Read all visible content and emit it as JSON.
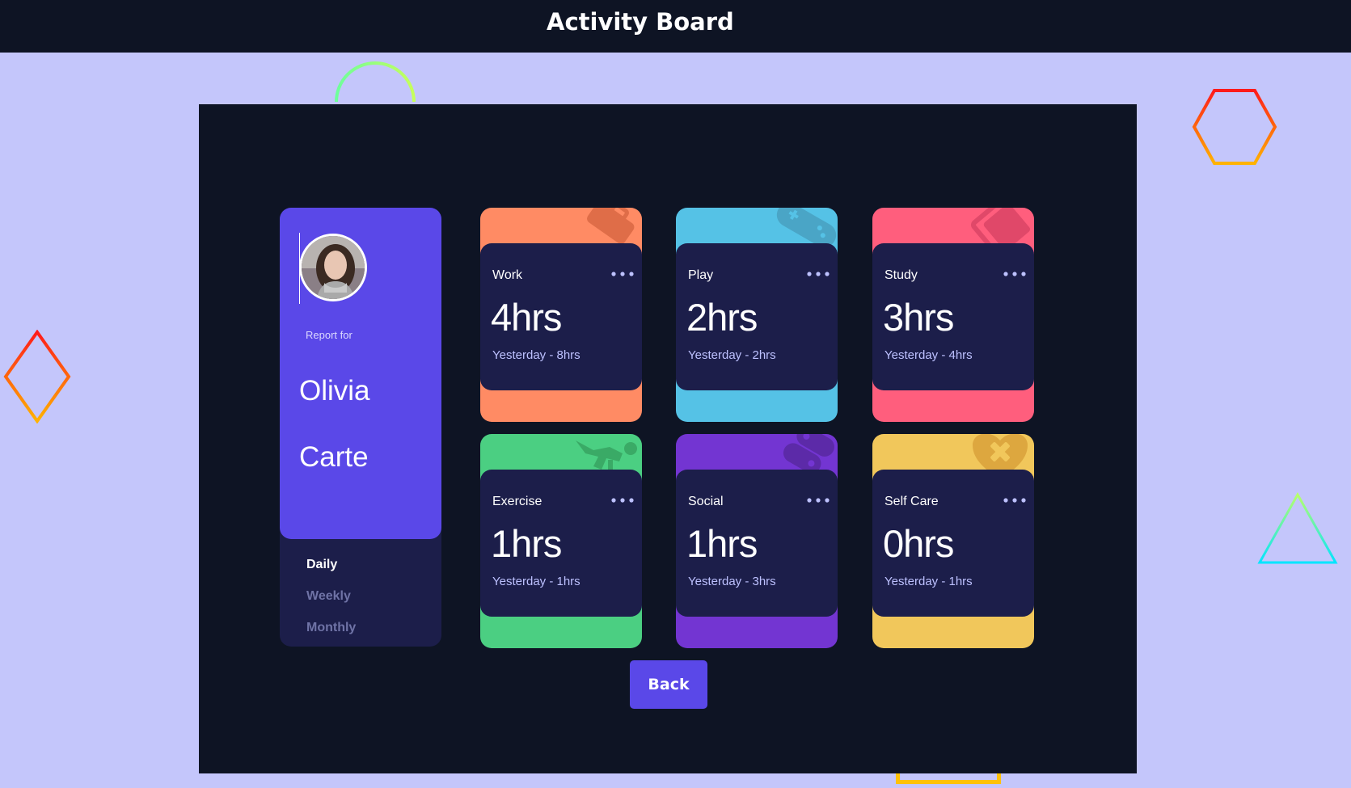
{
  "header": {
    "title": "Activity Board"
  },
  "profile": {
    "report_label": "Report for",
    "first_name": "Olivia",
    "last_name": "Carte",
    "periods": [
      {
        "label": "Daily",
        "active": true
      },
      {
        "label": "Weekly",
        "active": false
      },
      {
        "label": "Monthly",
        "active": false
      }
    ]
  },
  "activities": [
    {
      "name": "Work",
      "hours": "4hrs",
      "previous": "Yesterday - 8hrs",
      "color": "#ff8b64",
      "icon": "briefcase-icon"
    },
    {
      "name": "Play",
      "hours": "2hrs",
      "previous": "Yesterday - 2hrs",
      "color": "#55c2e6",
      "icon": "gamepad-icon"
    },
    {
      "name": "Study",
      "hours": "3hrs",
      "previous": "Yesterday - 4hrs",
      "color": "#ff5e7d",
      "icon": "book-icon"
    },
    {
      "name": "Exercise",
      "hours": "1hrs",
      "previous": "Yesterday - 1hrs",
      "color": "#4bcf82",
      "icon": "running-icon"
    },
    {
      "name": "Social",
      "hours": "1hrs",
      "previous": "Yesterday - 3hrs",
      "color": "#7335d2",
      "icon": "social-icon"
    },
    {
      "name": "Self Care",
      "hours": "0hrs",
      "previous": "Yesterday - 1hrs",
      "color": "#f1c75b",
      "icon": "heart-icon"
    }
  ],
  "actions": {
    "back_label": "Back"
  },
  "colors": {
    "accent": "#5a48e8",
    "card": "#1c1e4a",
    "panel": "#0e1424",
    "page": "#c4c6fb"
  }
}
